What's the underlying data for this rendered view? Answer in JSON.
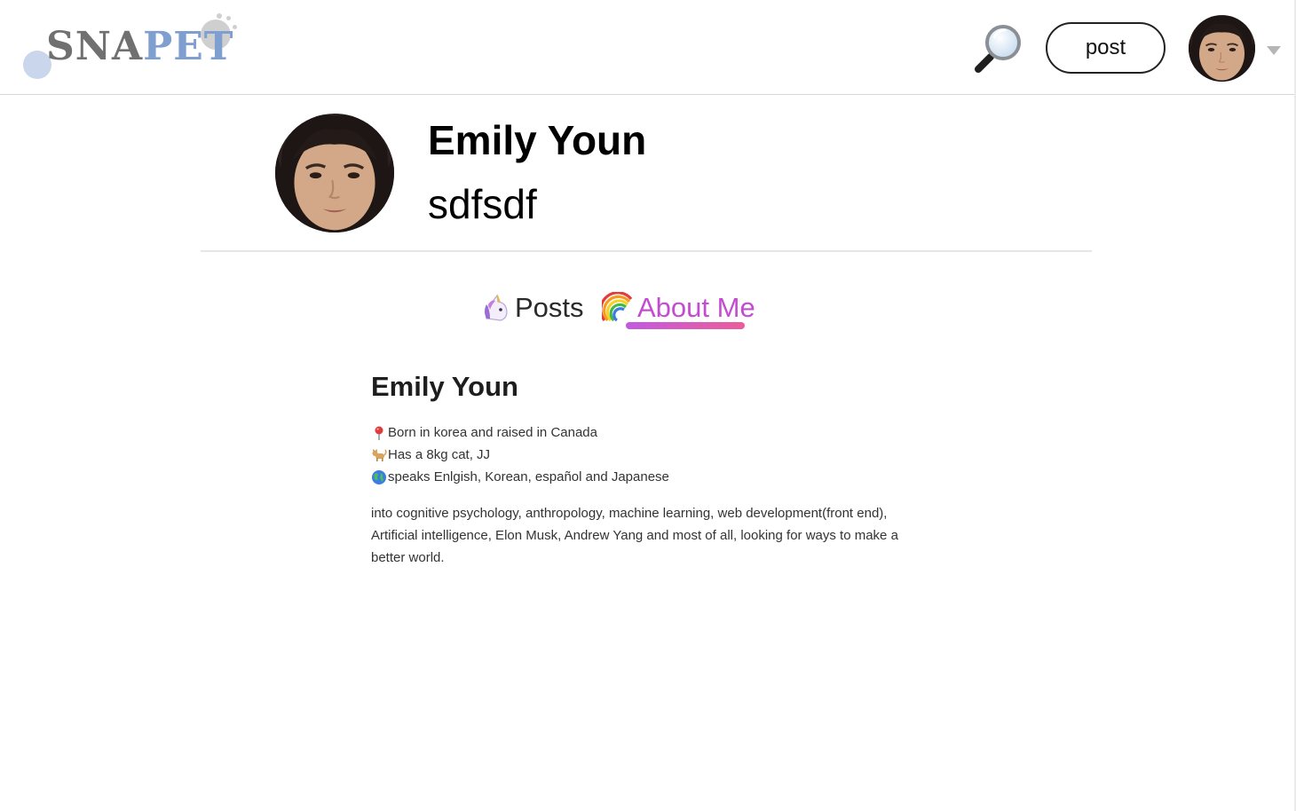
{
  "header": {
    "logo": {
      "part1": "SNA",
      "part2": "PET"
    },
    "search": {
      "icon": "magnifier-icon"
    },
    "post_button_label": "post",
    "account_menu": {
      "icon": "chevron-down-icon"
    }
  },
  "profile": {
    "name": "Emily Youn",
    "handle": "sdfsdf"
  },
  "tabs": [
    {
      "icon": "unicorn-icon",
      "label": "Posts",
      "active": false
    },
    {
      "icon": "rainbow-icon",
      "label": "About Me",
      "active": true
    }
  ],
  "about": {
    "title": "Emily Youn",
    "facts": [
      {
        "icon": "pin-icon",
        "text": "Born in korea and raised in Canada"
      },
      {
        "icon": "cat-icon",
        "text": "Has a 8kg cat, JJ"
      },
      {
        "icon": "globe-icon",
        "text": "speaks Enlgish, Korean, español and Japanese"
      }
    ],
    "bio_lines": [
      "into cognitive psychology, anthropology, machine learning, web development(front end),",
      "Artificial intelligence, Elon Musk, Andrew Yang and most of all, looking for ways to make a",
      "better world."
    ]
  },
  "colors": {
    "active_tab": "#c44cd0",
    "underline_start": "#c25ae0",
    "underline_end": "#ec5d9a",
    "logo_grey": "#707070",
    "logo_blue": "#7f9fd1"
  }
}
